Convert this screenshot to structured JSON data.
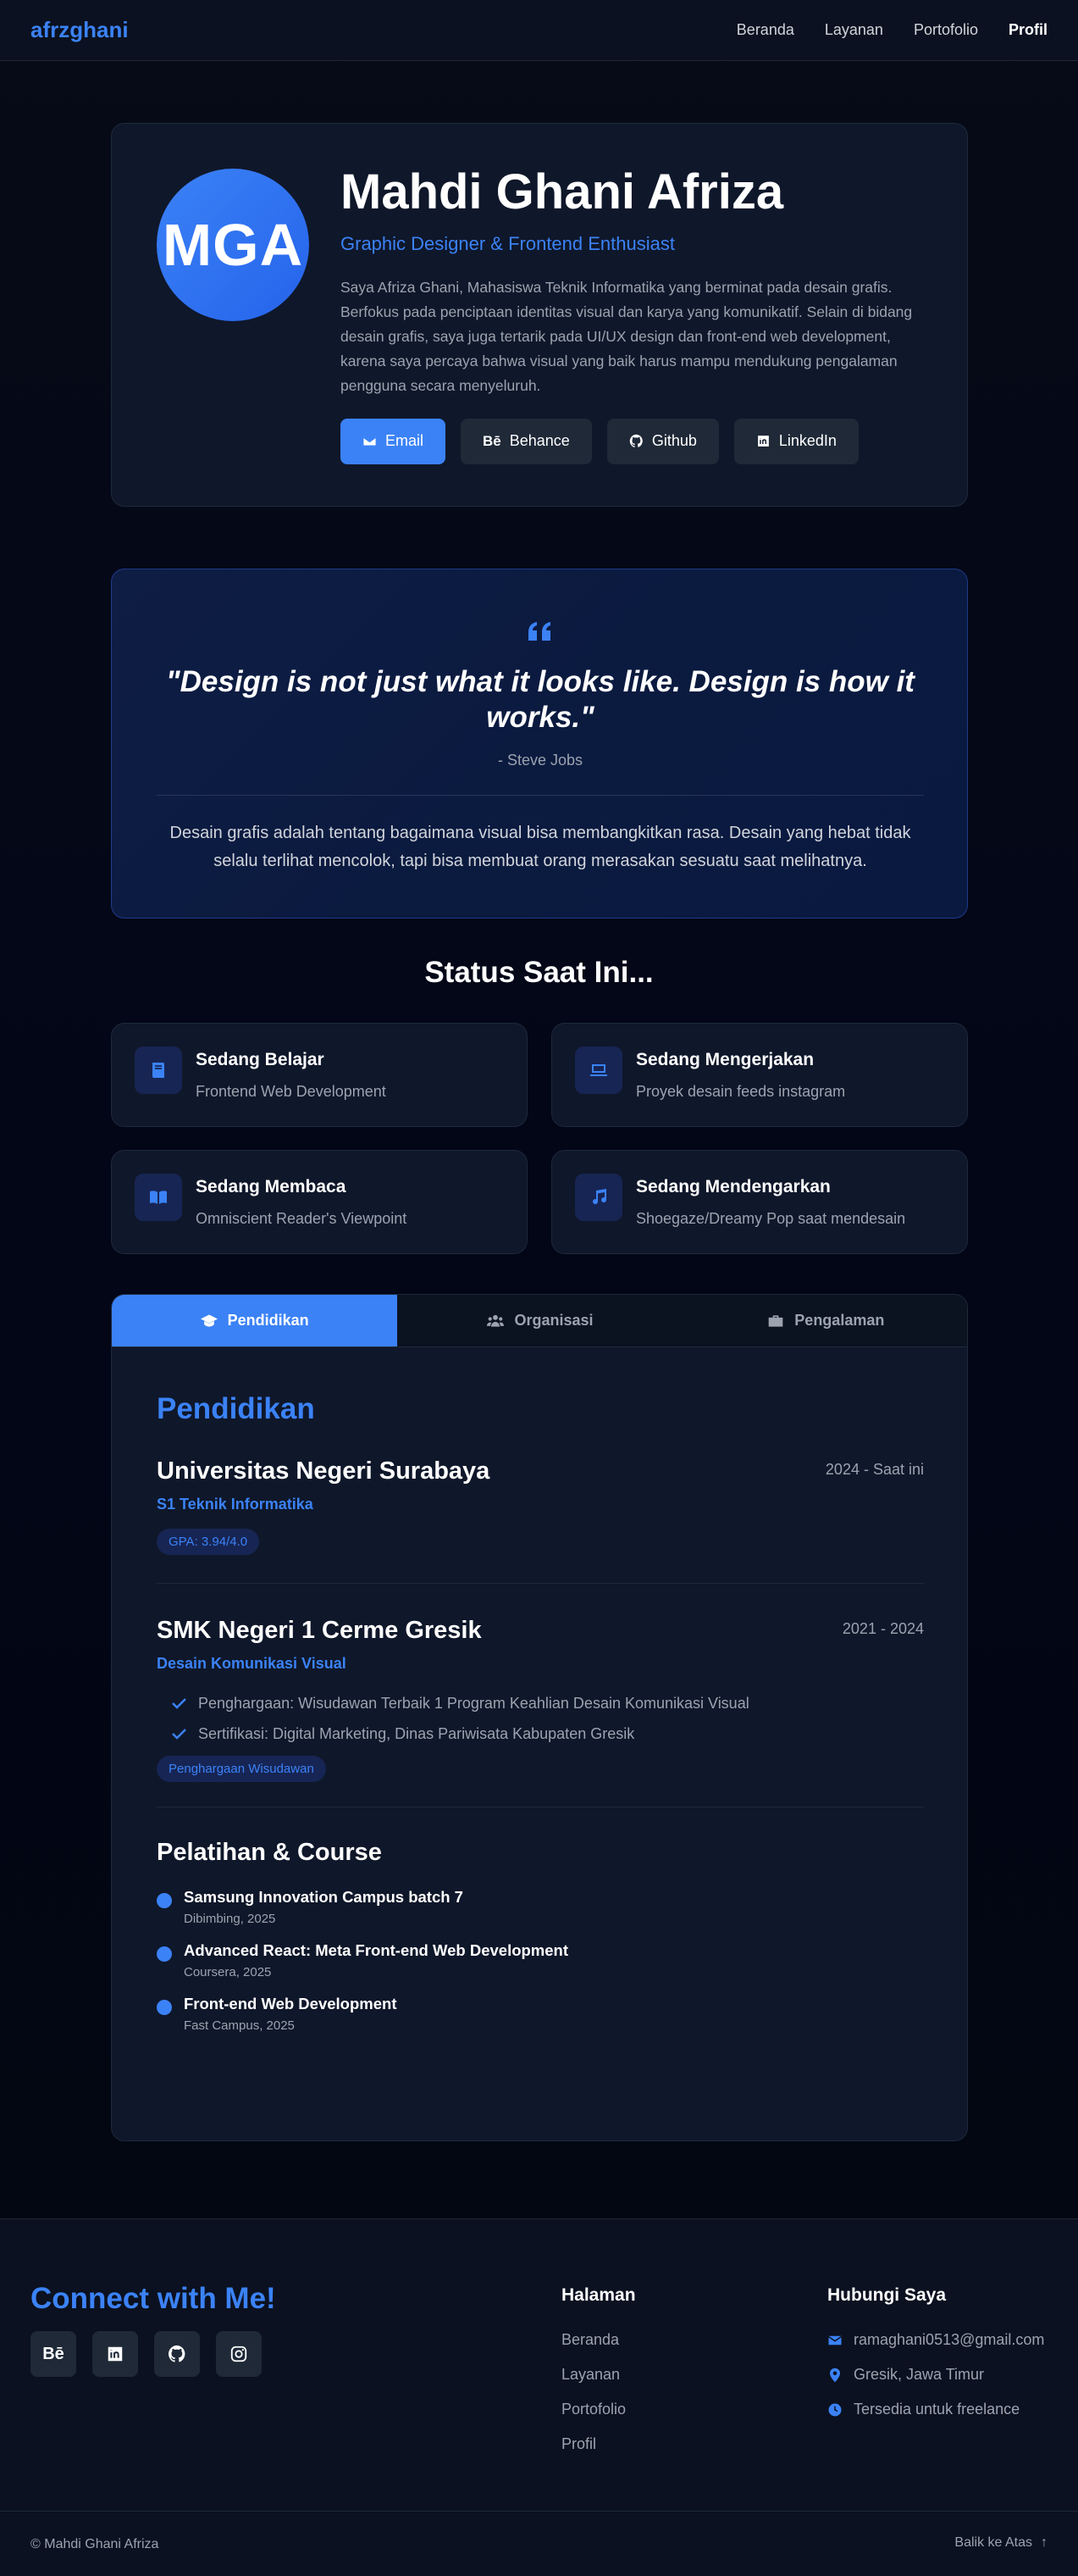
{
  "nav": {
    "brand": "afrzghani",
    "links": [
      "Beranda",
      "Layanan",
      "Portofolio",
      "Profil"
    ]
  },
  "hero": {
    "initials": "MGA",
    "name": "Mahdi Ghani Afriza",
    "role": "Graphic Designer & Frontend Enthusiast",
    "bio": "Saya Afriza Ghani, Mahasiswa Teknik Informatika yang berminat pada desain grafis. Berfokus pada penciptaan identitas visual dan karya yang komunikatif. Selain di bidang desain grafis, saya juga tertarik pada UI/UX design dan front-end web development, karena saya percaya bahwa visual yang baik harus mampu mendukung pengalaman pengguna secara menyeluruh.",
    "buttons": {
      "email": "Email",
      "behance": "Behance",
      "github": "Github",
      "linkedin": "LinkedIn"
    }
  },
  "quote": {
    "text": "\"Design is not just what it looks like. Design is how it works.\"",
    "author": "- Steve Jobs",
    "description": "Desain grafis adalah tentang bagaimana visual bisa membangkitkan rasa. Desain yang hebat tidak selalu terlihat mencolok, tapi bisa membuat orang merasakan sesuatu saat melihatnya."
  },
  "status": {
    "title": "Status Saat Ini...",
    "items": [
      {
        "title": "Sedang Belajar",
        "desc": "Frontend Web Development",
        "icon": "book-icon"
      },
      {
        "title": "Sedang Mengerjakan",
        "desc": "Proyek desain feeds instagram",
        "icon": "laptop-icon"
      },
      {
        "title": "Sedang Membaca",
        "desc": "Omniscient Reader's Viewpoint",
        "icon": "open-book-icon"
      },
      {
        "title": "Sedang Mendengarkan",
        "desc": "Shoegaze/Dreamy Pop saat mendesain",
        "icon": "music-icon"
      }
    ]
  },
  "tabs": {
    "items": [
      "Pendidikan",
      "Organisasi",
      "Pengalaman"
    ],
    "active": "Pendidikan"
  },
  "education": {
    "heading": "Pendidikan",
    "schools": [
      {
        "name": "Universitas Negeri Surabaya",
        "period": "2024 - Saat ini",
        "major": "S1 Teknik Informatika",
        "badge": "GPA: 3.94/4.0"
      },
      {
        "name": "SMK Negeri 1 Cerme Gresik",
        "period": "2021 - 2024",
        "major": "Desain Komunikasi Visual",
        "achievements": [
          "Penghargaan: Wisudawan Terbaik 1 Program Keahlian Desain Komunikasi Visual",
          "Sertifikasi: Digital Marketing, Dinas Pariwisata Kabupaten Gresik"
        ],
        "badge": "Penghargaan Wisudawan"
      }
    ],
    "courses_title": "Pelatihan & Course",
    "courses": [
      {
        "name": "Samsung Innovation Campus batch 7",
        "meta": "Dibimbing, 2025"
      },
      {
        "name": "Advanced React: Meta Front-end Web Development",
        "meta": "Coursera, 2025"
      },
      {
        "name": "Front-end Web Development",
        "meta": "Fast Campus, 2025"
      }
    ]
  },
  "footer": {
    "connect": "Connect with Me!",
    "social_behance": "Bē",
    "pages_title": "Halaman",
    "pages": [
      "Beranda",
      "Layanan",
      "Portofolio",
      "Profil"
    ],
    "contact_title": "Hubungi Saya",
    "contact": {
      "email": "ramaghani0513@gmail.com",
      "location": "Gresik, Jawa Timur",
      "availability": "Tersedia untuk freelance"
    },
    "copyright": "© Mahdi Ghani Afriza",
    "back_to_top": "Balik ke Atas",
    "back_to_top_arrow": "↑"
  },
  "colors": {
    "accent": "#3b82f6",
    "background": "#030712",
    "card": "#0f172a"
  }
}
